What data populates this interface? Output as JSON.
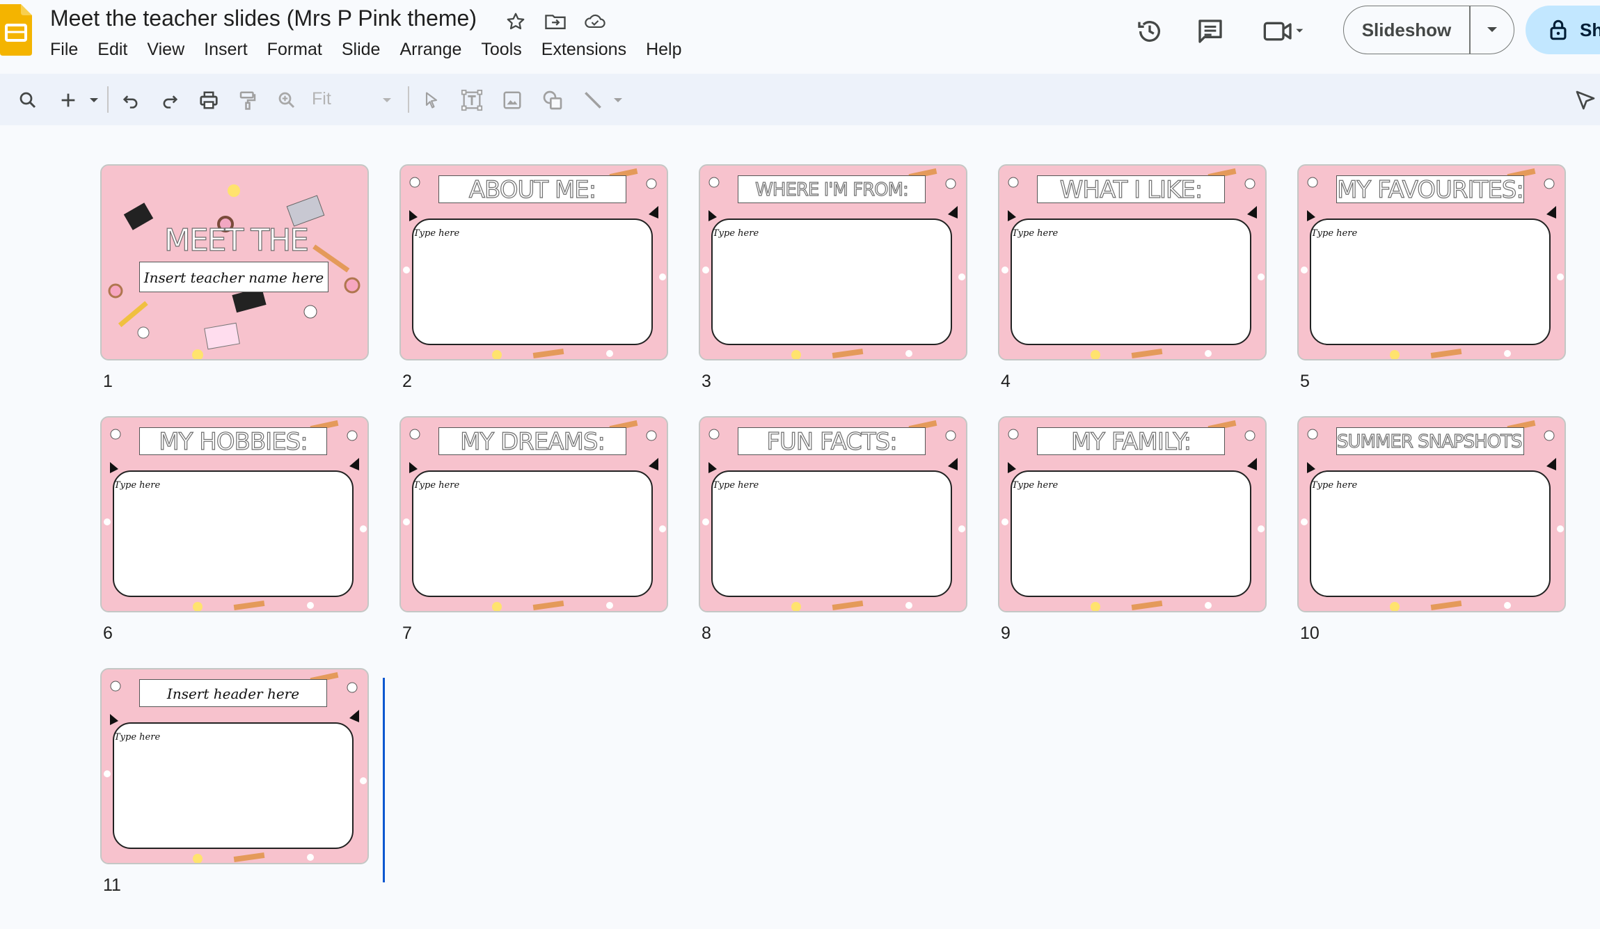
{
  "header": {
    "title": "Meet the teacher slides (Mrs P Pink theme)",
    "menus": [
      "File",
      "Edit",
      "View",
      "Insert",
      "Format",
      "Slide",
      "Arrange",
      "Tools",
      "Extensions",
      "Help"
    ],
    "slideshow_label": "Slideshow",
    "share_label": "Sh"
  },
  "toolbar": {
    "zoom_value": "Fit"
  },
  "slides": [
    {
      "number": "1",
      "kind": "cover",
      "title": "MEET THE TEACHER",
      "subtitle": "Insert teacher name here"
    },
    {
      "number": "2",
      "kind": "content",
      "header": "ABOUT ME:",
      "body": "Type here"
    },
    {
      "number": "3",
      "kind": "content",
      "header": "WHERE I'M FROM:",
      "body": "Type here"
    },
    {
      "number": "4",
      "kind": "content",
      "header": "WHAT I LIKE:",
      "body": "Type here"
    },
    {
      "number": "5",
      "kind": "content",
      "header": "MY FAVOURITES:",
      "body": "Type here"
    },
    {
      "number": "6",
      "kind": "content",
      "header": "MY HOBBIES:",
      "body": "Type here"
    },
    {
      "number": "7",
      "kind": "content",
      "header": "MY DREAMS:",
      "body": "Type here"
    },
    {
      "number": "8",
      "kind": "content",
      "header": "FUN FACTS:",
      "body": "Type here"
    },
    {
      "number": "9",
      "kind": "content",
      "header": "MY FAMILY:",
      "body": "Type here"
    },
    {
      "number": "10",
      "kind": "content",
      "header": "SUMMER SNAPSHOTS:",
      "body": "Type here"
    },
    {
      "number": "11",
      "kind": "content-plain",
      "header": "Insert header here",
      "body": "Type here"
    }
  ],
  "colors": {
    "slide_pink": "#f7c2cd",
    "accent_blue": "#0b57d0",
    "share_bg": "#c2e7ff",
    "logo_yellow": "#f4b400"
  }
}
